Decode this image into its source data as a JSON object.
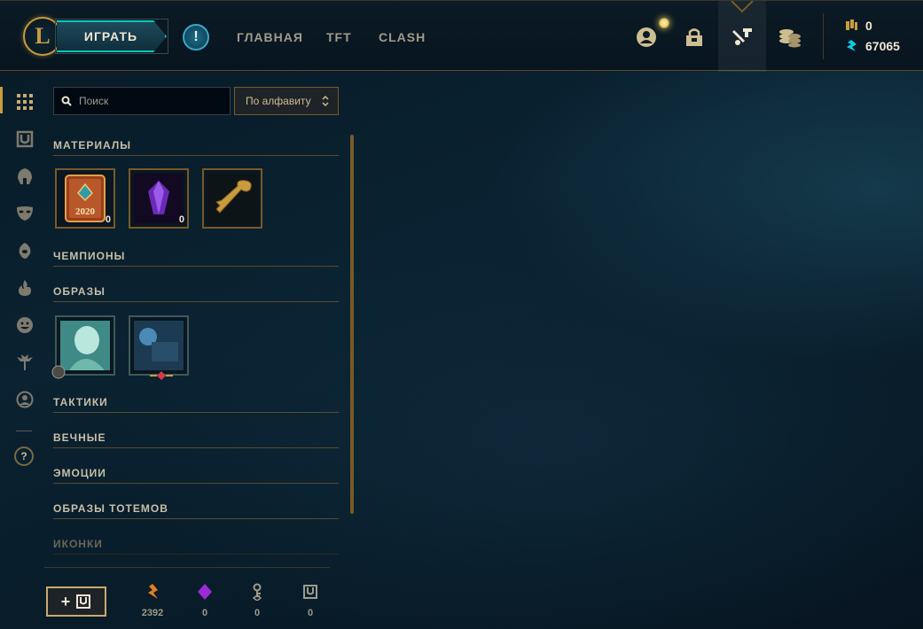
{
  "topbar": {
    "logo_letter": "L",
    "play_label": "ИГРАТЬ",
    "alert_glyph": "!",
    "nav": [
      {
        "label": "ГЛАВНАЯ"
      },
      {
        "label": "TFT"
      },
      {
        "label": "CLASH"
      }
    ],
    "icons": [
      "profile-icon",
      "collection-icon",
      "crafting-icon",
      "store-icon"
    ],
    "currency": {
      "rp": "0",
      "blue_essence": "67065"
    }
  },
  "sidebar": {
    "icons": [
      "grid-icon",
      "chest-icon",
      "champion-helmet-icon",
      "skin-mask-icon",
      "ward-icon",
      "fire-icon",
      "emote-icon",
      "tactician-icon",
      "profile-icon"
    ],
    "help_glyph": "?"
  },
  "inventory": {
    "search_placeholder": "Поиск",
    "sort_label": "По алфавиту",
    "categories": [
      {
        "label": "МАТЕРИАЛЫ"
      },
      {
        "label": "ЧЕМПИОНЫ"
      },
      {
        "label": "ОБРАЗЫ"
      },
      {
        "label": "ТАКТИКИ"
      },
      {
        "label": "ВЕЧНЫЕ"
      },
      {
        "label": "ЭМОЦИИ"
      },
      {
        "label": "ОБРАЗЫ ТОТЕМОВ"
      },
      {
        "label": "ИКОНКИ"
      }
    ],
    "materials": [
      {
        "icon": "event-pass-2020-icon",
        "year": "2020",
        "count": "0"
      },
      {
        "icon": "purple-gem-icon",
        "count": "0"
      },
      {
        "icon": "hextech-key-fragment-icon",
        "count": ""
      }
    ],
    "skins": [
      {
        "icon": "skin-shard-teal-icon"
      },
      {
        "icon": "skin-shard-blue-icon"
      }
    ]
  },
  "footer": {
    "add_label": "+",
    "resources": [
      {
        "icon": "orange-essence-icon",
        "value": "2392"
      },
      {
        "icon": "mythic-gem-icon",
        "value": "0"
      },
      {
        "icon": "key-icon",
        "value": "0"
      },
      {
        "icon": "chest-icon",
        "value": "0"
      }
    ]
  },
  "colors": {
    "gold": "#c89b3c",
    "teal": "#0ac8b9",
    "text_gold": "#cdbe91"
  }
}
